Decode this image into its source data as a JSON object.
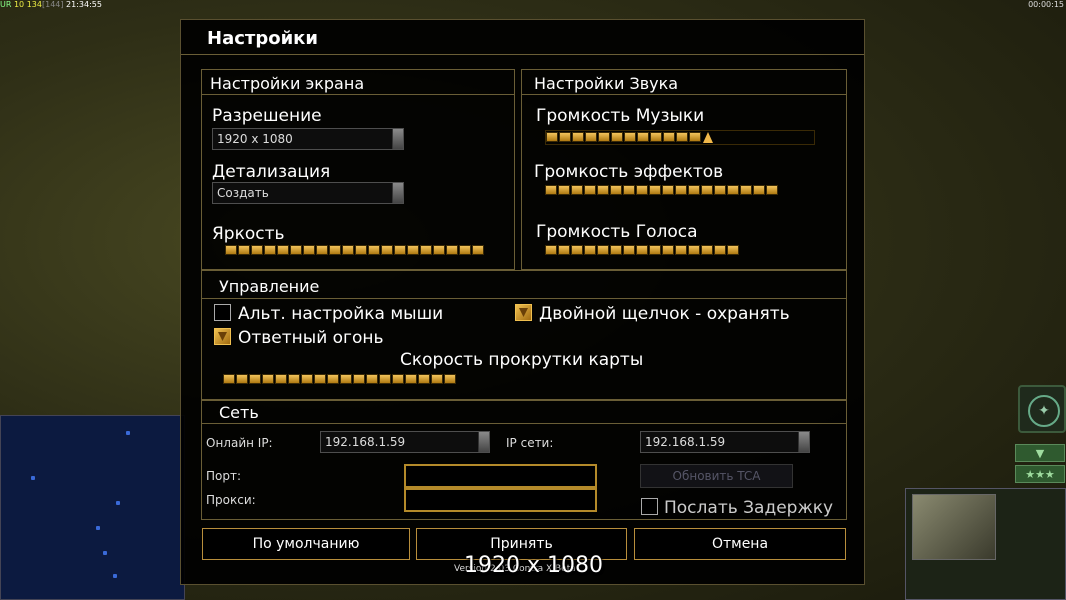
{
  "hud": {
    "top_left_a": "UR",
    "top_left_b": "10",
    "top_left_c": "134",
    "top_left_d": "[144]",
    "clock": "21:34:55",
    "timer": "00:00:15",
    "stars": "★★★",
    "down_arrow": "▼"
  },
  "dialog": {
    "title": "Настройки",
    "screen": {
      "header": "Настройки экрана",
      "resolution_label": "Разрешение",
      "resolution_value": "1920 x 1080",
      "detail_label": "Детализация",
      "detail_value": "Создать",
      "brightness_label": "Яркость",
      "brightness_level": 1.0
    },
    "sound": {
      "header": "Настройки Звука",
      "music_label": "Громкость Музыки",
      "music_level": 0.55,
      "effects_label": "Громкость эффектов",
      "effects_level": 1.0,
      "voice_label": "Громкость Голоса",
      "voice_level": 1.0
    },
    "controls": {
      "header": "Управление",
      "alt_mouse_label": "Альт. настройка мыши",
      "alt_mouse_checked": false,
      "double_click_label": "Двойной щелчок - охранять",
      "double_click_checked": true,
      "return_fire_label": "Ответный огонь",
      "return_fire_checked": true,
      "scroll_speed_label": "Скорость прокрутки карты",
      "scroll_speed_level": 1.0
    },
    "network": {
      "header": "Сеть",
      "online_ip_label": "Онлайн IP:",
      "online_ip_value": "192.168.1.59",
      "lan_ip_label": "IP сети:",
      "lan_ip_value": "192.168.1.59",
      "port_label": "Порт:",
      "port_value": "",
      "proxy_label": "Прокси:",
      "proxy_value": "",
      "update_tca_label": "Обновить TCA",
      "send_delay_label": "Послать Задержку",
      "send_delay_checked": false
    },
    "buttons": {
      "defaults": "По умолчанию",
      "accept": "Принять",
      "cancel": "Отмена"
    }
  },
  "overlay": {
    "resolution_text": "1920 x 1080",
    "version_text": "Version 2.03 Contra X Beta"
  }
}
